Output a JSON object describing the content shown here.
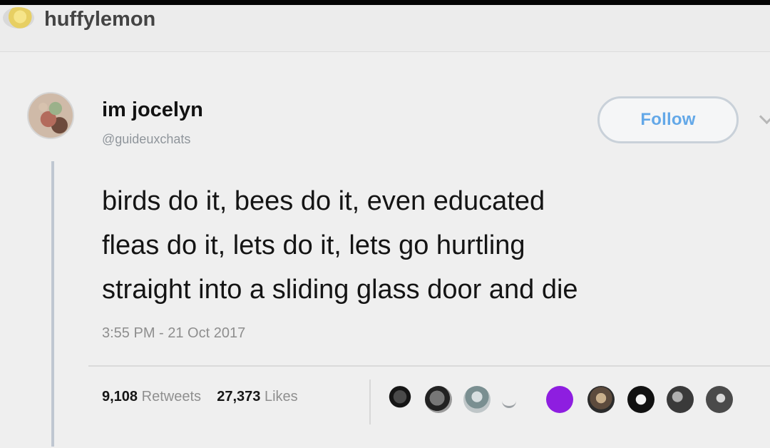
{
  "tumblr": {
    "username": "huffylemon"
  },
  "tweet": {
    "display_name": "im jocelyn",
    "handle": "@guideuxchats",
    "follow_label": "Follow",
    "text_lines": [
      "birds do it, bees do it, even educated",
      "fleas do it, lets do it, lets go hurtling",
      "straight into a sliding glass door and die"
    ],
    "timestamp": "3:55 PM - 21 Oct 2017",
    "retweets_count": "9,108",
    "retweets_label": "Retweets",
    "likes_count": "27,373",
    "likes_label": "Likes"
  },
  "icons": {
    "more": "chevron-down-icon",
    "avatar": "profile-avatar",
    "likers": "liker-avatar"
  },
  "colors": {
    "follow_text": "#63a8e8",
    "thread_line": "#bfc7d1",
    "purple_avatar": "#8e1ee0"
  }
}
